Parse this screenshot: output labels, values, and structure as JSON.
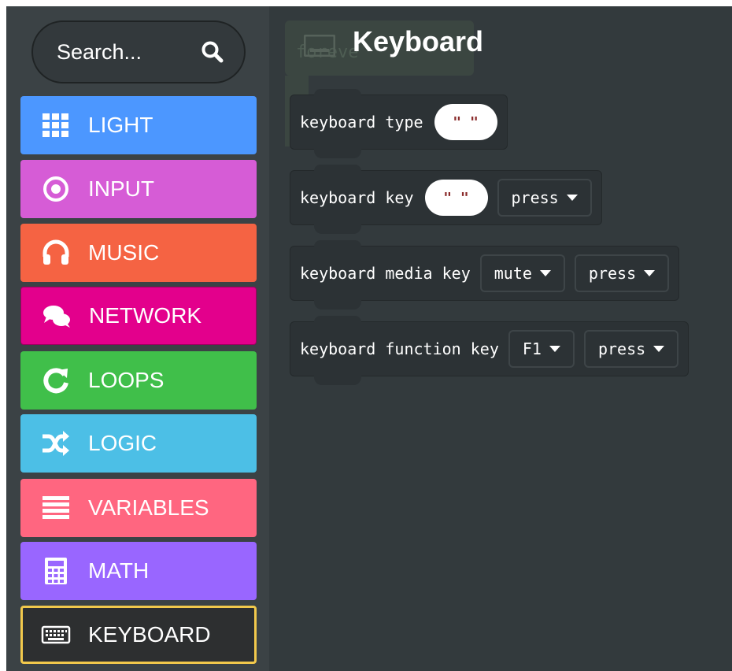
{
  "toolbox": {
    "search": {
      "placeholder": "Search...",
      "icon": "search-icon"
    },
    "categories": [
      {
        "label": "LIGHT",
        "icon": "grid-icon",
        "color": "#4c97ff"
      },
      {
        "label": "INPUT",
        "icon": "target-icon",
        "color": "#d65cd6"
      },
      {
        "label": "MUSIC",
        "icon": "headphones-icon",
        "color": "#f56343"
      },
      {
        "label": "NETWORK",
        "icon": "chat-icon",
        "color": "#e3008c"
      },
      {
        "label": "LOOPS",
        "icon": "refresh-icon",
        "color": "#40bf4a"
      },
      {
        "label": "LOGIC",
        "icon": "shuffle-icon",
        "color": "#4cbfe6"
      },
      {
        "label": "VARIABLES",
        "icon": "list-icon",
        "color": "#ff6680"
      },
      {
        "label": "MATH",
        "icon": "calculator-icon",
        "color": "#9966ff"
      },
      {
        "label": "KEYBOARD",
        "icon": "keyboard-icon",
        "color": "#2d2f30",
        "selected": true,
        "border": "#f2c94c"
      }
    ]
  },
  "flyout": {
    "title": "Keyboard",
    "title_icon": "keyboard-icon",
    "background_block_label": "foreve",
    "blocks": [
      {
        "label": "keyboard type",
        "string_value": "\" \""
      },
      {
        "label": "keyboard key",
        "string_value": "\" \"",
        "dropdown": "press"
      },
      {
        "label": "keyboard media key",
        "dropdown1": "mute",
        "dropdown2": "press"
      },
      {
        "label": "keyboard function key",
        "dropdown1": "F1",
        "dropdown2": "press"
      }
    ]
  }
}
